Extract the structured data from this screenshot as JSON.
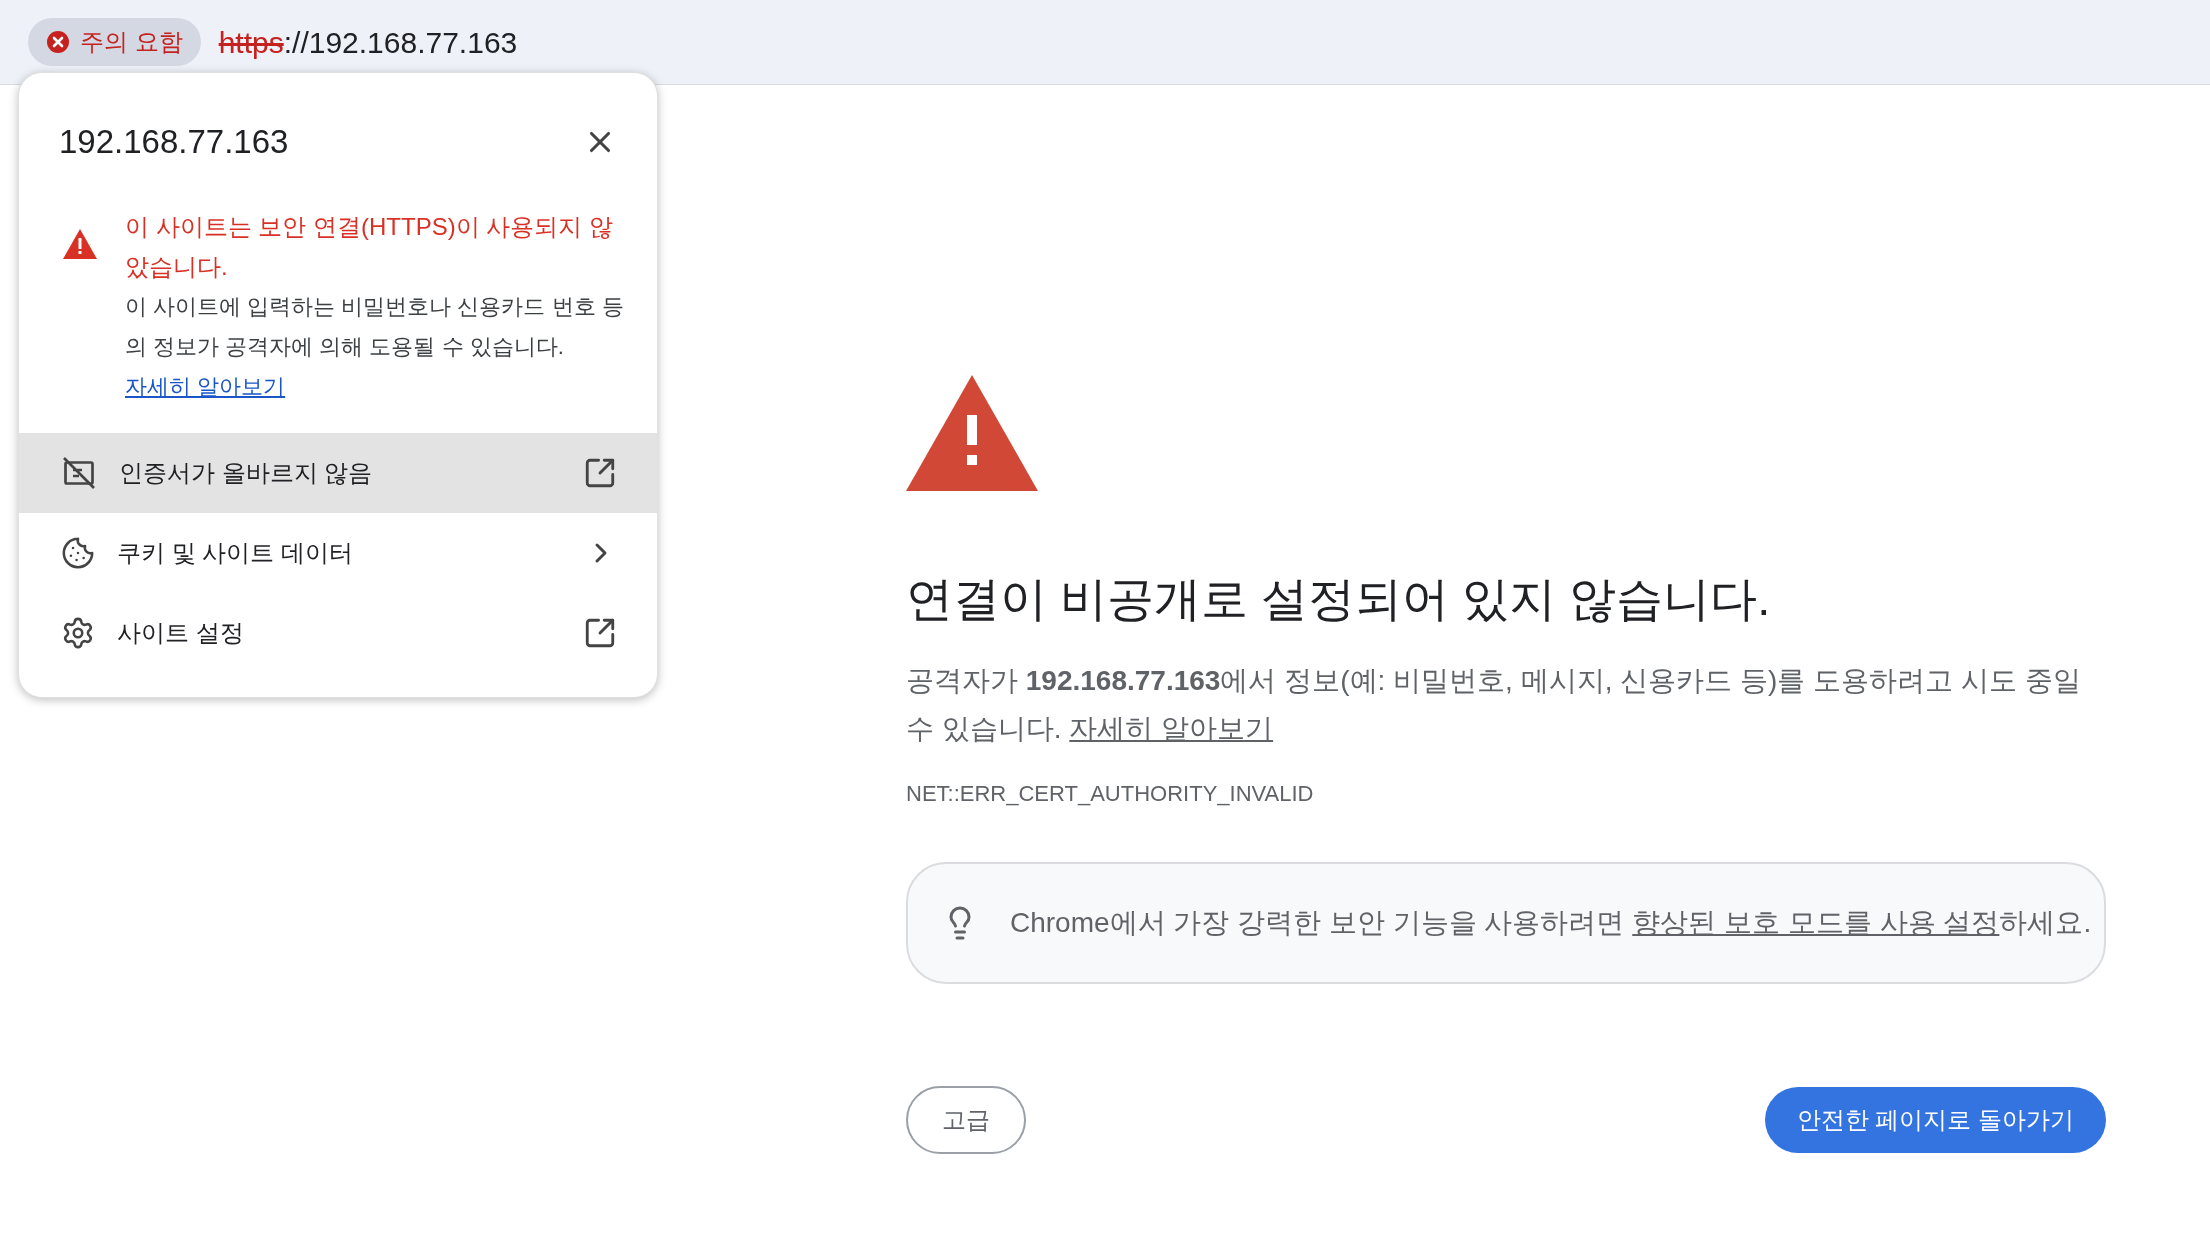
{
  "address_bar": {
    "security_chip": "주의 요함",
    "url_scheme": "https",
    "url_rest": "://192.168.77.163"
  },
  "popup": {
    "title": "192.168.77.163",
    "warning_title": "이 사이트는 보안 연결(HTTPS)이 사용되지 않았습니다.",
    "warning_body": "이 사이트에 입력하는 비밀번호나 신용카드 번호 등의 정보가 공격자에 의해 도용될 수 있습니다.",
    "learn_more": "자세히 알아보기",
    "items": [
      {
        "kind": "certificate",
        "label": "인증서가 올바르지 않음",
        "opens_externally": true,
        "selected": true
      },
      {
        "kind": "cookie",
        "label": "쿠키 및 사이트 데이터",
        "opens_externally": false,
        "selected": false
      },
      {
        "kind": "settings",
        "label": "사이트 설정",
        "opens_externally": true,
        "selected": false
      }
    ]
  },
  "page": {
    "heading": "연결이 비공개로 설정되어 있지 않습니다.",
    "description": "공격자가 **192.168.77.163**에서 정보(예: 비밀번호, 메시지, 신용카드 등)를 도용하려고 시도 중일 수 있습니다.",
    "learn_more": "자세히 알아보기",
    "error_code": "NET::ERR_CERT_AUTHORITY_INVALID",
    "tip": {
      "before": "Chrome에서 가장 강력한 보안 기능을 사용하려면 ",
      "link": "향상된 보호 모드를 사용 설정",
      "after": "하세요."
    },
    "advanced_button": "고급",
    "back_button": "안전한 페이지로 돌아가기"
  }
}
